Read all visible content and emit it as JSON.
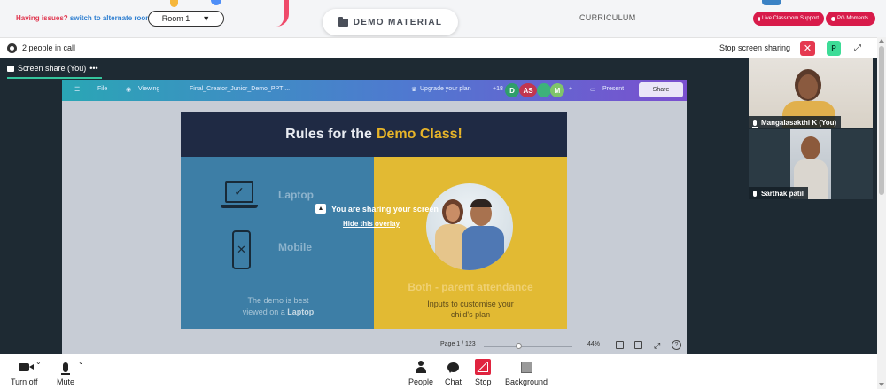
{
  "header": {
    "issues_text": "Having issues?",
    "alternate_link": "switch to alternate room",
    "room_selected": "Room 1",
    "demo_material_label": "DEMO MATERIAL",
    "curriculum_label": "CURRICULUM",
    "support_label": "Live Classroom Support",
    "moments_label": "PG Moments"
  },
  "call": {
    "people_in_call": "2 people in call",
    "stop_sharing_label": "Stop screen sharing",
    "avatar_initial": "P",
    "tab_label": "Screen share (You)",
    "tab_more": "•••"
  },
  "shared_screen": {
    "toolbar": {
      "file": "File",
      "viewing": "Viewing",
      "doc_title": "Final_Creator_Junior_Demo_PPT ...",
      "upgrade": "Upgrade your plan",
      "collab_count": "+18",
      "avatar_d": "D",
      "avatar_as": "AS",
      "avatar_m": "M",
      "present": "Present",
      "share": "Share"
    },
    "slide": {
      "title_main": "Rules for the",
      "title_accent": "Demo Class!",
      "laptop_label": "Laptop",
      "mobile_label": "Mobile",
      "best_viewed_line1": "The demo is best",
      "best_viewed_line2_prefix": "viewed on a",
      "best_viewed_line2_bold": "Laptop",
      "both_label": "Both - parent attendance",
      "inputs_line1": "Inputs to customise your",
      "inputs_line2": "child's plan"
    },
    "overlay": {
      "sharing_text": "You are sharing your screen",
      "hide_text": "Hide this overlay"
    },
    "footer": {
      "page_indicator": "Page 1 / 123",
      "zoom": "44%"
    }
  },
  "participants": [
    {
      "name": "Mangalasakthi K (You)"
    },
    {
      "name": "Sarthak patil"
    }
  ],
  "toolbar": {
    "turn_off": "Turn off",
    "mute": "Mute",
    "people": "People",
    "chat": "Chat",
    "stop": "Stop",
    "background": "Background"
  },
  "colors": {
    "brand_pink": "#d81b4a",
    "share_accent": "#35c59d",
    "stop_red": "#e0243f"
  }
}
